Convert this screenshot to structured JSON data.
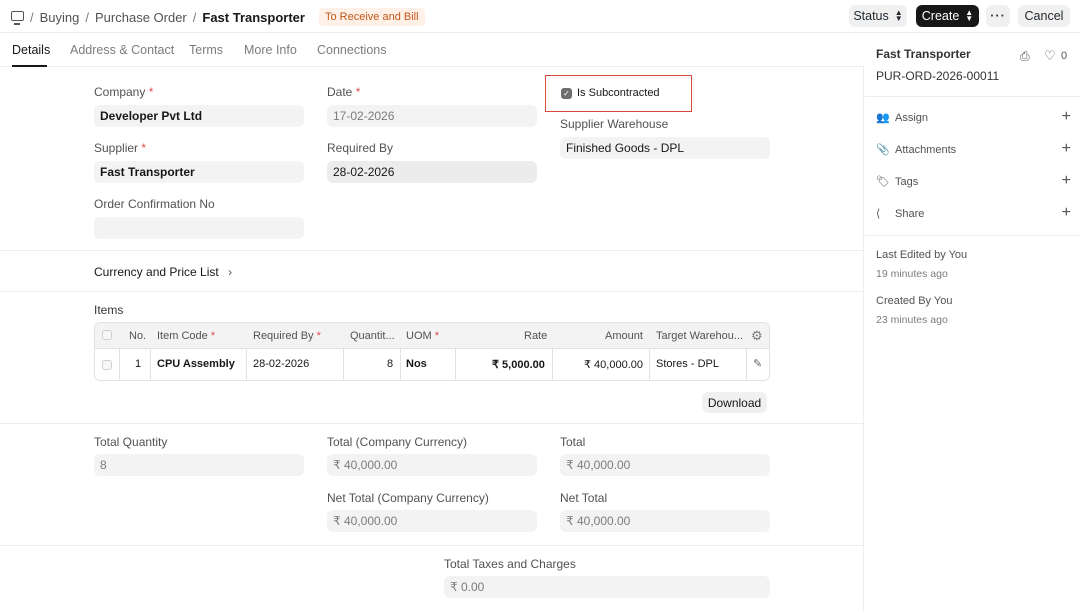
{
  "breadcrumb": {
    "items": [
      "Buying",
      "Purchase Order"
    ],
    "current": "Fast Transporter",
    "status_badge": "To Receive and Bill"
  },
  "toolbar": {
    "status_label": "Status",
    "create_label": "Create",
    "more_label": "···",
    "cancel_label": "Cancel"
  },
  "tabs": [
    {
      "label": "Details",
      "active": true
    },
    {
      "label": "Address & Contact",
      "active": false
    },
    {
      "label": "Terms",
      "active": false
    },
    {
      "label": "More Info",
      "active": false
    },
    {
      "label": "Connections",
      "active": false
    }
  ],
  "form": {
    "company_label": "Company",
    "company_value": "Developer Pvt Ltd",
    "date_label": "Date",
    "date_value": "17-02-2026",
    "is_subcontracted_label": "Is Subcontracted",
    "is_subcontracted_checked": true,
    "supplier_warehouse_label": "Supplier Warehouse",
    "supplier_warehouse_value": "Finished Goods - DPL",
    "supplier_label": "Supplier",
    "supplier_value": "Fast Transporter",
    "required_by_label": "Required By",
    "required_by_value": "28-02-2026",
    "order_confirmation_label": "Order Confirmation No",
    "order_confirmation_value": "",
    "required_marker": "*"
  },
  "currency_section": {
    "title": "Currency and Price List",
    "chevron": "›"
  },
  "items": {
    "title": "Items",
    "columns": [
      "No.",
      "Item Code",
      "Required By",
      "Quantit...",
      "UOM",
      "Rate",
      "Amount",
      "Target Warehou..."
    ],
    "rows": [
      {
        "no": "1",
        "item_code": "CPU Assembly",
        "required_by": "28-02-2026",
        "qty": "8",
        "uom": "Nos",
        "rate": "₹ 5,000.00",
        "amount": "₹ 40,000.00",
        "target_warehouse": "Stores - DPL"
      }
    ],
    "download_label": "Download"
  },
  "totals": {
    "total_quantity_label": "Total Quantity",
    "total_quantity_value": "8",
    "total_company_label": "Total (Company Currency)",
    "total_company_value": "₹ 40,000.00",
    "total_label": "Total",
    "total_value": "₹ 40,000.00",
    "net_total_company_label": "Net Total (Company Currency)",
    "net_total_company_value": "₹ 40,000.00",
    "net_total_label": "Net Total",
    "net_total_value": "₹ 40,000.00",
    "taxes_label": "Total Taxes and Charges",
    "taxes_value": "₹ 0.00"
  },
  "sidebar": {
    "title": "Fast Transporter",
    "doc_id": "PUR-ORD-2026-00011",
    "likes": "0",
    "actions": [
      {
        "label": "Assign",
        "icon": "assign-icon"
      },
      {
        "label": "Attachments",
        "icon": "paperclip-icon"
      },
      {
        "label": "Tags",
        "icon": "tag-icon"
      },
      {
        "label": "Share",
        "icon": "share-icon"
      }
    ],
    "last_edited": "Last Edited by You",
    "last_edited_ago": "19 minutes ago",
    "created": "Created By You",
    "created_ago": "23 minutes ago"
  },
  "colors": {
    "accent": "#171717",
    "badge_bg": "#fff1e7",
    "badge_text": "#c4571a",
    "highlight_border": "#d94a3c"
  }
}
